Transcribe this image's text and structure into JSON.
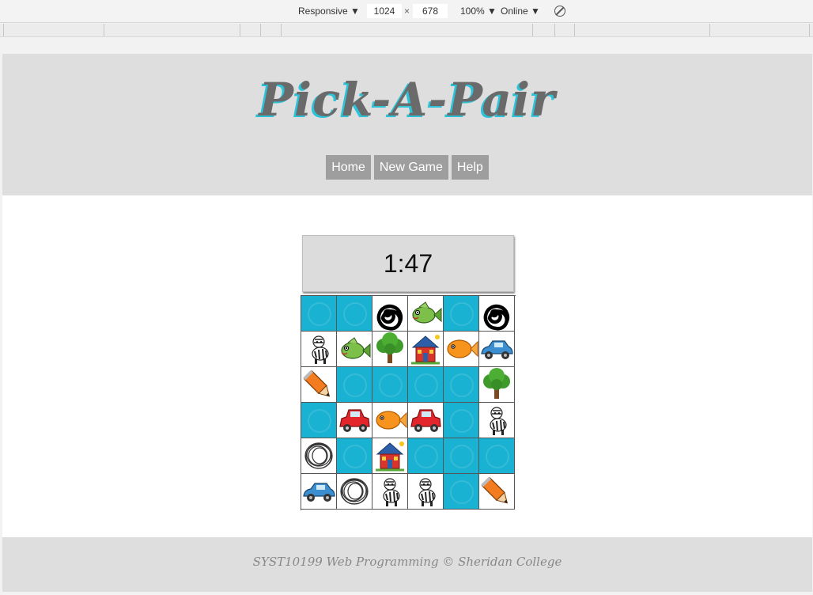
{
  "devtools": {
    "device": "Responsive",
    "width": "1024",
    "times": "×",
    "height": "678",
    "zoom": "100%",
    "network": "Online"
  },
  "site": {
    "title": "Pick-A-Pair",
    "nav": [
      "Home",
      "New Game",
      "Help"
    ],
    "timer": "1:47",
    "footer": "SYST10199 Web Programming © Sheridan College"
  },
  "colors": {
    "card_back": "#1ab2d2",
    "header_bg": "#dedede",
    "nav_bg": "#9e9e9e",
    "title_shadow": "#2cc3d8"
  },
  "board": [
    [
      "back",
      "back",
      "spiral",
      "fish-green",
      "back",
      "spiral"
    ],
    [
      "zebra",
      "fish-green",
      "tree",
      "house",
      "fish-orange",
      "car-blue"
    ],
    [
      "pencil",
      "back",
      "back",
      "back",
      "back",
      "tree"
    ],
    [
      "back",
      "car-red",
      "fish-orange",
      "car-red",
      "back",
      "zebra"
    ],
    [
      "scribble",
      "back",
      "house",
      "back",
      "back",
      "back"
    ],
    [
      "car-blue",
      "scribble",
      "zebra",
      "zebra",
      "back",
      "pencil"
    ]
  ]
}
